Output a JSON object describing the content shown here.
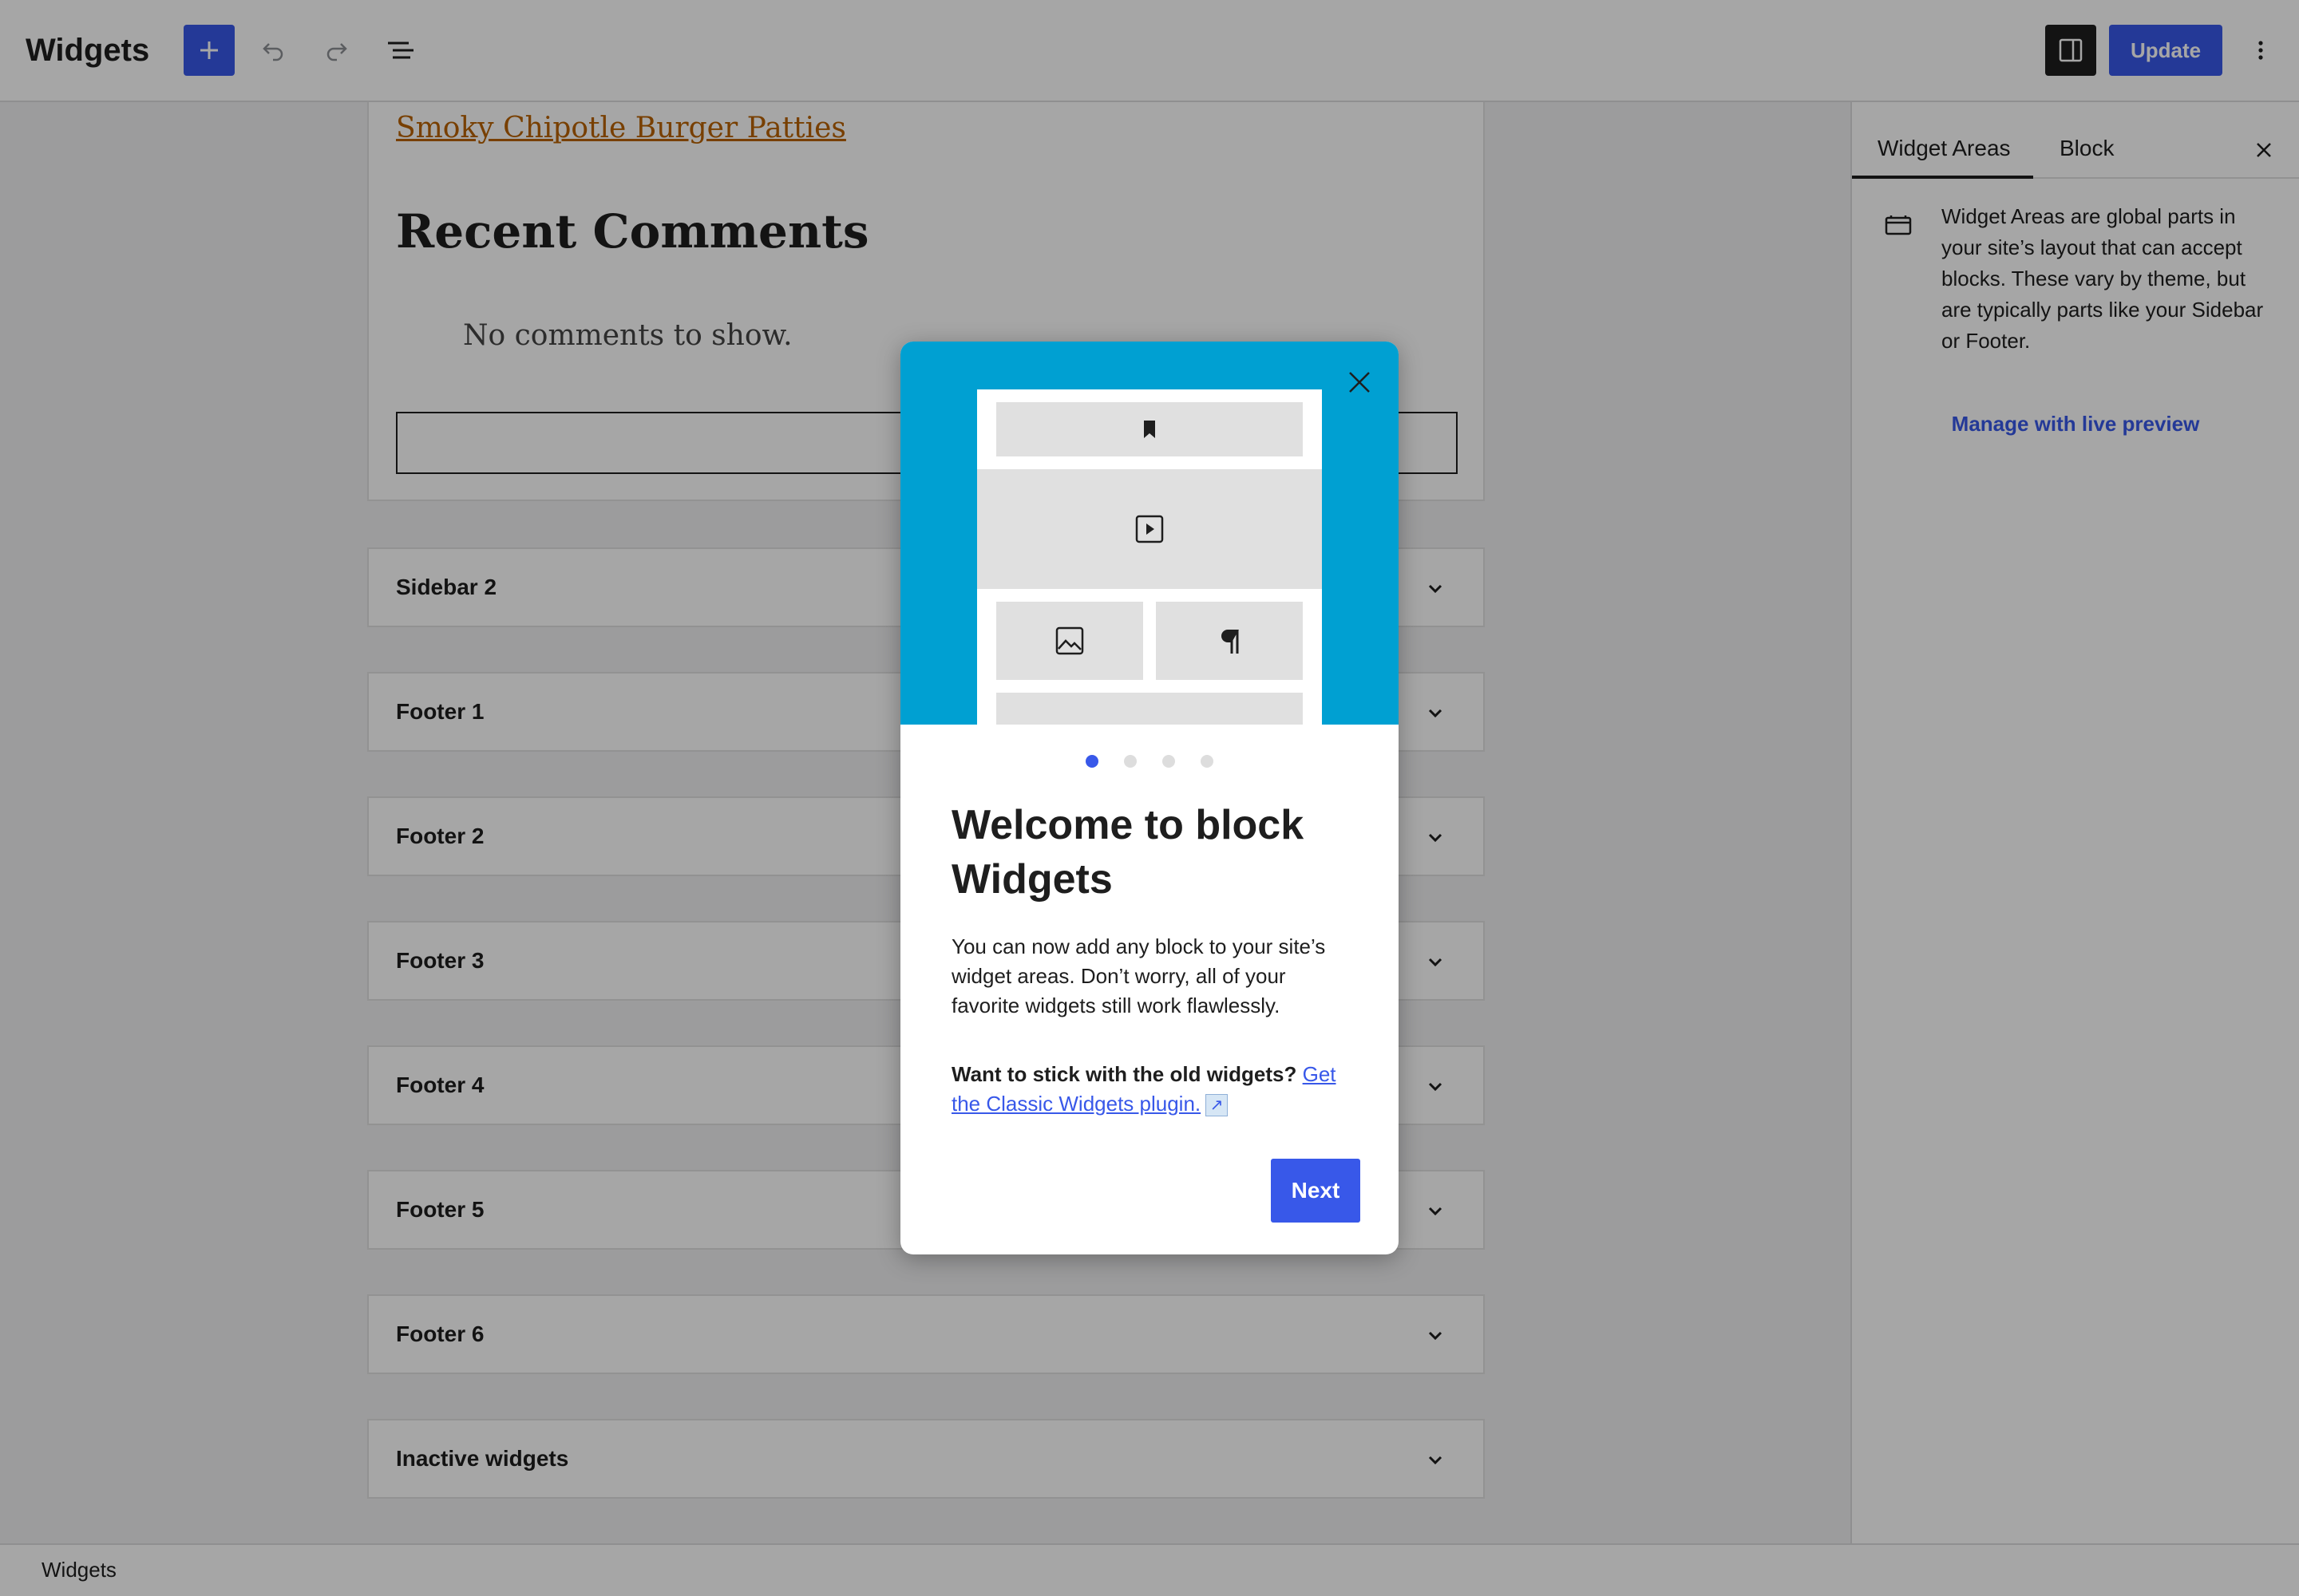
{
  "header": {
    "title": "Widgets",
    "update_label": "Update",
    "icons": {
      "add": "plus-icon",
      "undo": "undo-icon",
      "redo": "redo-icon",
      "list_view": "list-view-icon",
      "settings": "sidebar-toggle-icon",
      "more": "more-vertical-icon"
    }
  },
  "canvas": {
    "open_area": {
      "post_link": "Smoky Chipotle Burger Patties",
      "heading": "Recent Comments",
      "empty_text": "No comments to show."
    },
    "widget_areas": [
      {
        "label": "Sidebar 2"
      },
      {
        "label": "Footer 1"
      },
      {
        "label": "Footer 2"
      },
      {
        "label": "Footer 3"
      },
      {
        "label": "Footer 4"
      },
      {
        "label": "Footer 5"
      },
      {
        "label": "Footer 6"
      },
      {
        "label": "Inactive widgets"
      }
    ]
  },
  "sidebar": {
    "tabs": [
      {
        "label": "Widget Areas",
        "active": true
      },
      {
        "label": "Block",
        "active": false
      }
    ],
    "description": "Widget Areas are global parts in your site’s layout that can accept blocks. These vary by theme, but are typically parts like your Sidebar or Footer.",
    "manage_link": "Manage with live preview"
  },
  "statusbar": {
    "label": "Widgets"
  },
  "modal": {
    "heading": "Welcome to block Widgets",
    "body": "You can now add any block to your site’s widget areas. Don’t worry, all of your favorite widgets still work flawlessly.",
    "old_widgets_question": "Want to stick with the old widgets?",
    "classic_link": "Get the Classic Widgets plugin.",
    "external_icon": "↗",
    "next_label": "Next",
    "page_count": 4,
    "current_page": 1,
    "hero_color": "#00a0d2",
    "accent_color": "#3858e9"
  }
}
